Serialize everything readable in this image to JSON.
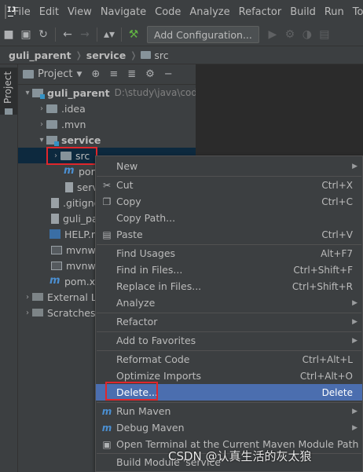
{
  "menubar": {
    "items": [
      "File",
      "Edit",
      "View",
      "Navigate",
      "Code",
      "Analyze",
      "Refactor",
      "Build",
      "Run",
      "Too"
    ]
  },
  "toolbar": {
    "config_label": "Add Configuration..."
  },
  "breadcrumb": {
    "items": [
      "guli_parent",
      "service",
      "src"
    ]
  },
  "stripe": {
    "tab_label": "Project"
  },
  "project_panel": {
    "title": "Project",
    "tree": [
      {
        "label": "guli_parent",
        "path": "D:\\study\\java\\code"
      },
      {
        "label": ".idea"
      },
      {
        "label": ".mvn"
      },
      {
        "label": "service"
      },
      {
        "label": "src"
      },
      {
        "label": "pom"
      },
      {
        "label": "serv"
      },
      {
        "label": ".gitigno"
      },
      {
        "label": "guli_pa"
      },
      {
        "label": "HELP.m"
      },
      {
        "label": "mvnw"
      },
      {
        "label": "mvnw.c"
      },
      {
        "label": "pom.xm"
      },
      {
        "label": "External Li"
      },
      {
        "label": "Scratches"
      }
    ]
  },
  "context_menu": {
    "items": [
      {
        "label": "New",
        "shortcut": ""
      },
      {
        "label": "Cut",
        "shortcut": "Ctrl+X"
      },
      {
        "label": "Copy",
        "shortcut": "Ctrl+C"
      },
      {
        "label": "Copy Path...",
        "shortcut": ""
      },
      {
        "label": "Paste",
        "shortcut": "Ctrl+V"
      },
      {
        "label": "Find Usages",
        "shortcut": "Alt+F7"
      },
      {
        "label": "Find in Files...",
        "shortcut": "Ctrl+Shift+F"
      },
      {
        "label": "Replace in Files...",
        "shortcut": "Ctrl+Shift+R"
      },
      {
        "label": "Analyze",
        "shortcut": ""
      },
      {
        "label": "Refactor",
        "shortcut": ""
      },
      {
        "label": "Add to Favorites",
        "shortcut": ""
      },
      {
        "label": "Reformat Code",
        "shortcut": "Ctrl+Alt+L"
      },
      {
        "label": "Optimize Imports",
        "shortcut": "Ctrl+Alt+O"
      },
      {
        "label": "Delete...",
        "shortcut": "Delete"
      },
      {
        "label": "Run Maven",
        "shortcut": ""
      },
      {
        "label": "Debug Maven",
        "shortcut": ""
      },
      {
        "label": "Open Terminal at the Current Maven Module Path",
        "shortcut": ""
      },
      {
        "label": "Build Module 'service'",
        "shortcut": ""
      }
    ]
  },
  "watermark": "CSDN @认真生活的灰太狼",
  "colors": {
    "selection": "#4b6eaf",
    "highlight_box": "#e0262b"
  }
}
